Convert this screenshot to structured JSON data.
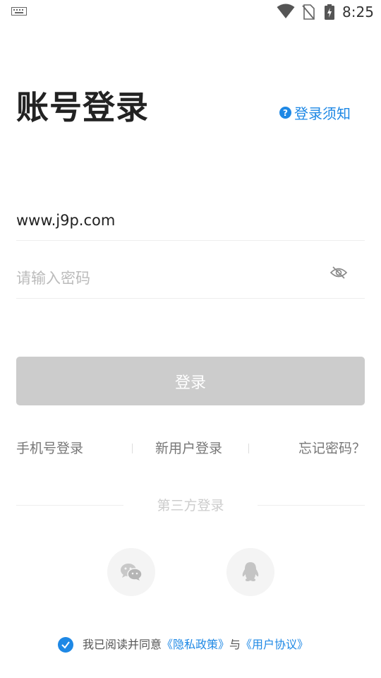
{
  "status_bar": {
    "time": "8:25",
    "icons": [
      "keyboard-icon",
      "wifi-icon",
      "no-sim-icon",
      "battery-charging-icon"
    ]
  },
  "header": {
    "title": "账号登录",
    "notice_label": "登录须知",
    "notice_icon": "help-icon"
  },
  "form": {
    "account_value": "www.j9p.com",
    "password_placeholder": "请输入密码",
    "password_toggle_icon": "eye-hidden-icon",
    "submit_label": "登录"
  },
  "links": {
    "phone_login": "手机号登录",
    "new_user_login": "新用户登录",
    "forgot_password": "忘记密码？"
  },
  "third_party": {
    "label": "第三方登录",
    "providers": [
      "wechat-icon",
      "qq-icon"
    ]
  },
  "agreement": {
    "prefix": "我已阅读并同意",
    "privacy_policy": "《隐私政策》",
    "conjunction": "与",
    "user_agreement": "《用户协议》",
    "checked": true
  },
  "colors": {
    "accent": "#1e88e5",
    "button_disabled": "#cccccc",
    "title_text": "#222222",
    "secondary_text": "#777777"
  }
}
